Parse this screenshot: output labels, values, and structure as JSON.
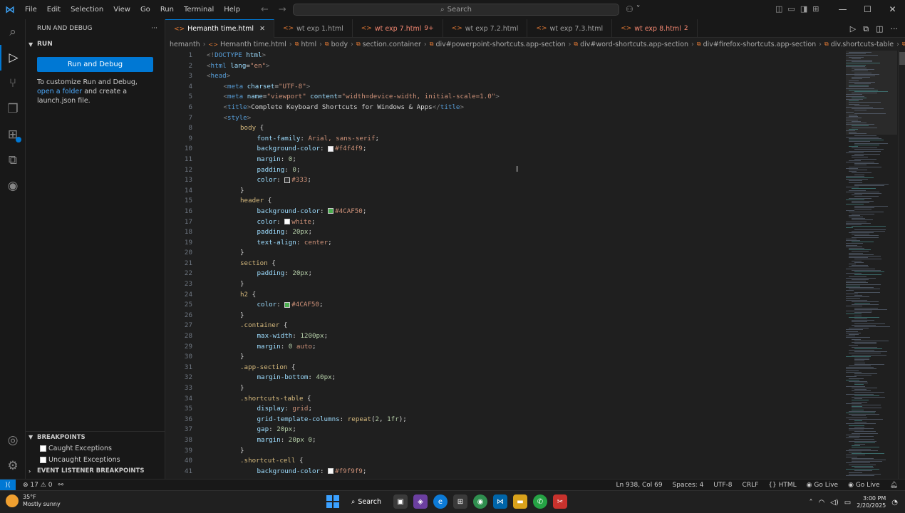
{
  "titlebar": {
    "menu": [
      "File",
      "Edit",
      "Selection",
      "View",
      "Go",
      "Run",
      "Terminal",
      "Help"
    ],
    "search_placeholder": "Search"
  },
  "sidebar": {
    "title": "RUN AND DEBUG",
    "more": "···",
    "run_section": "RUN",
    "run_button": "Run and Debug",
    "help_text_1": "To customize Run and Debug,",
    "help_link_1": "open a folder",
    "help_text_2": "and create a launch.json file.",
    "breakpoints": {
      "title": "BREAKPOINTS",
      "items": [
        "Caught Exceptions",
        "Uncaught Exceptions"
      ],
      "event_listener": "EVENT LISTENER BREAKPOINTS"
    }
  },
  "tabs": [
    {
      "label": "Hemanth time.html",
      "active": true,
      "error": false,
      "suffix": ""
    },
    {
      "label": "wt exp 1.html",
      "active": false,
      "error": false,
      "suffix": ""
    },
    {
      "label": "wt exp 7.html",
      "active": false,
      "error": true,
      "suffix": "9+"
    },
    {
      "label": "wt exp 7.2.html",
      "active": false,
      "error": false,
      "suffix": ""
    },
    {
      "label": "wt exp 7.3.html",
      "active": false,
      "error": false,
      "suffix": ""
    },
    {
      "label": "wt exp 8.html",
      "active": false,
      "error": true,
      "suffix": "2"
    }
  ],
  "breadcrumbs": [
    "hemanth",
    "Hemanth time.html",
    "html",
    "body",
    "section.container",
    "div#powerpoint-shortcuts.app-section",
    "div#word-shortcuts.app-section",
    "div#firefox-shortcuts.app-section",
    "div.shortcuts-table",
    "div"
  ],
  "code_lines": [
    {
      "n": "1",
      "i": 0,
      "tokens": [
        [
          "p",
          "<!"
        ],
        [
          "t",
          "DOCTYPE"
        ],
        [
          "a",
          " html"
        ],
        [
          "p",
          ">"
        ]
      ]
    },
    {
      "n": "2",
      "i": 0,
      "tokens": [
        [
          "p",
          "<"
        ],
        [
          "t",
          "html"
        ],
        [
          "a",
          " lang"
        ],
        [
          "d",
          "="
        ],
        [
          "s",
          "\"en\""
        ],
        [
          "p",
          ">"
        ]
      ]
    },
    {
      "n": "3",
      "i": 0,
      "tokens": [
        [
          "p",
          "<"
        ],
        [
          "t",
          "head"
        ],
        [
          "p",
          ">"
        ]
      ]
    },
    {
      "n": "4",
      "i": 1,
      "tokens": [
        [
          "p",
          "<"
        ],
        [
          "t",
          "meta"
        ],
        [
          "a",
          " charset"
        ],
        [
          "d",
          "="
        ],
        [
          "s",
          "\"UTF-8\""
        ],
        [
          "p",
          ">"
        ]
      ]
    },
    {
      "n": "5",
      "i": 1,
      "tokens": [
        [
          "p",
          "<"
        ],
        [
          "t",
          "meta"
        ],
        [
          "a",
          " name"
        ],
        [
          "d",
          "="
        ],
        [
          "s",
          "\"viewport\""
        ],
        [
          "a",
          " content"
        ],
        [
          "d",
          "="
        ],
        [
          "s",
          "\"width=device-width, initial-scale=1.0\""
        ],
        [
          "p",
          ">"
        ]
      ]
    },
    {
      "n": "6",
      "i": 1,
      "tokens": [
        [
          "p",
          "<"
        ],
        [
          "t",
          "title"
        ],
        [
          "p",
          ">"
        ],
        [
          "d",
          "Complete Keyboard Shortcuts for Windows & Apps"
        ],
        [
          "p",
          "</"
        ],
        [
          "t",
          "title"
        ],
        [
          "p",
          ">"
        ]
      ]
    },
    {
      "n": "7",
      "i": 1,
      "tokens": [
        [
          "p",
          "<"
        ],
        [
          "t",
          "style"
        ],
        [
          "p",
          ">"
        ]
      ]
    },
    {
      "n": "8",
      "i": 2,
      "tokens": [
        [
          "sel",
          "body"
        ],
        [
          "d",
          " {"
        ]
      ]
    },
    {
      "n": "9",
      "i": 3,
      "tokens": [
        [
          "k",
          "font-family"
        ],
        [
          "d",
          ": "
        ],
        [
          "v",
          "Arial, sans-serif"
        ],
        [
          "d",
          ";"
        ]
      ]
    },
    {
      "n": "10",
      "i": 3,
      "tokens": [
        [
          "k",
          "background-color"
        ],
        [
          "d",
          ": "
        ],
        [
          "sw",
          "#f4f4f9"
        ],
        [
          "v",
          "#f4f4f9"
        ],
        [
          "d",
          ";"
        ]
      ]
    },
    {
      "n": "11",
      "i": 3,
      "tokens": [
        [
          "k",
          "margin"
        ],
        [
          "d",
          ": "
        ],
        [
          "n",
          "0"
        ],
        [
          "d",
          ";"
        ]
      ]
    },
    {
      "n": "12",
      "i": 3,
      "tokens": [
        [
          "k",
          "padding"
        ],
        [
          "d",
          ": "
        ],
        [
          "n",
          "0"
        ],
        [
          "d",
          ";"
        ]
      ]
    },
    {
      "n": "13",
      "i": 3,
      "tokens": [
        [
          "k",
          "color"
        ],
        [
          "d",
          ": "
        ],
        [
          "sw",
          "#333"
        ],
        [
          "v",
          "#333"
        ],
        [
          "d",
          ";"
        ]
      ]
    },
    {
      "n": "14",
      "i": 2,
      "tokens": [
        [
          "d",
          "}"
        ]
      ]
    },
    {
      "n": "15",
      "i": 2,
      "tokens": [
        [
          "sel",
          "header"
        ],
        [
          "d",
          " {"
        ]
      ]
    },
    {
      "n": "16",
      "i": 3,
      "tokens": [
        [
          "k",
          "background-color"
        ],
        [
          "d",
          ": "
        ],
        [
          "sw",
          "#4CAF50"
        ],
        [
          "v",
          "#4CAF50"
        ],
        [
          "d",
          ";"
        ]
      ]
    },
    {
      "n": "17",
      "i": 3,
      "tokens": [
        [
          "k",
          "color"
        ],
        [
          "d",
          ": "
        ],
        [
          "sw",
          "white"
        ],
        [
          "v",
          "white"
        ],
        [
          "d",
          ";"
        ]
      ]
    },
    {
      "n": "18",
      "i": 3,
      "tokens": [
        [
          "k",
          "padding"
        ],
        [
          "d",
          ": "
        ],
        [
          "n",
          "20px"
        ],
        [
          "d",
          ";"
        ]
      ]
    },
    {
      "n": "19",
      "i": 3,
      "tokens": [
        [
          "k",
          "text-align"
        ],
        [
          "d",
          ": "
        ],
        [
          "v",
          "center"
        ],
        [
          "d",
          ";"
        ]
      ]
    },
    {
      "n": "20",
      "i": 2,
      "tokens": [
        [
          "d",
          "}"
        ]
      ]
    },
    {
      "n": "21",
      "i": 2,
      "tokens": [
        [
          "sel",
          "section"
        ],
        [
          "d",
          " {"
        ]
      ]
    },
    {
      "n": "22",
      "i": 3,
      "tokens": [
        [
          "k",
          "padding"
        ],
        [
          "d",
          ": "
        ],
        [
          "n",
          "20px"
        ],
        [
          "d",
          ";"
        ]
      ]
    },
    {
      "n": "23",
      "i": 2,
      "tokens": [
        [
          "d",
          "}"
        ]
      ]
    },
    {
      "n": "24",
      "i": 2,
      "tokens": [
        [
          "sel",
          "h2"
        ],
        [
          "d",
          " {"
        ]
      ]
    },
    {
      "n": "25",
      "i": 3,
      "tokens": [
        [
          "k",
          "color"
        ],
        [
          "d",
          ": "
        ],
        [
          "sw",
          "#4CAF50"
        ],
        [
          "v",
          "#4CAF50"
        ],
        [
          "d",
          ";"
        ]
      ]
    },
    {
      "n": "26",
      "i": 2,
      "tokens": [
        [
          "d",
          "}"
        ]
      ]
    },
    {
      "n": "27",
      "i": 2,
      "tokens": [
        [
          "sel",
          ".container"
        ],
        [
          "d",
          " {"
        ]
      ]
    },
    {
      "n": "28",
      "i": 3,
      "tokens": [
        [
          "k",
          "max-width"
        ],
        [
          "d",
          ": "
        ],
        [
          "n",
          "1200px"
        ],
        [
          "d",
          ";"
        ]
      ]
    },
    {
      "n": "29",
      "i": 3,
      "tokens": [
        [
          "k",
          "margin"
        ],
        [
          "d",
          ": "
        ],
        [
          "n",
          "0"
        ],
        [
          "v",
          " auto"
        ],
        [
          "d",
          ";"
        ]
      ]
    },
    {
      "n": "30",
      "i": 2,
      "tokens": [
        [
          "d",
          "}"
        ]
      ]
    },
    {
      "n": "31",
      "i": 2,
      "tokens": [
        [
          "sel",
          ".app-section"
        ],
        [
          "d",
          " {"
        ]
      ]
    },
    {
      "n": "32",
      "i": 3,
      "tokens": [
        [
          "k",
          "margin-bottom"
        ],
        [
          "d",
          ": "
        ],
        [
          "n",
          "40px"
        ],
        [
          "d",
          ";"
        ]
      ]
    },
    {
      "n": "33",
      "i": 2,
      "tokens": [
        [
          "d",
          "}"
        ]
      ]
    },
    {
      "n": "34",
      "i": 2,
      "tokens": [
        [
          "sel",
          ".shortcuts-table"
        ],
        [
          "d",
          " {"
        ]
      ]
    },
    {
      "n": "35",
      "i": 3,
      "tokens": [
        [
          "k",
          "display"
        ],
        [
          "d",
          ": "
        ],
        [
          "v",
          "grid"
        ],
        [
          "d",
          ";"
        ]
      ]
    },
    {
      "n": "36",
      "i": 3,
      "tokens": [
        [
          "k",
          "grid-template-columns"
        ],
        [
          "d",
          ": "
        ],
        [
          "fn",
          "repeat"
        ],
        [
          "d",
          "("
        ],
        [
          "n",
          "2"
        ],
        [
          "d",
          ", "
        ],
        [
          "n",
          "1fr"
        ],
        [
          "d",
          ");"
        ]
      ]
    },
    {
      "n": "37",
      "i": 3,
      "tokens": [
        [
          "k",
          "gap"
        ],
        [
          "d",
          ": "
        ],
        [
          "n",
          "20px"
        ],
        [
          "d",
          ";"
        ]
      ]
    },
    {
      "n": "38",
      "i": 3,
      "tokens": [
        [
          "k",
          "margin"
        ],
        [
          "d",
          ": "
        ],
        [
          "n",
          "20px"
        ],
        [
          "d",
          " "
        ],
        [
          "n",
          "0"
        ],
        [
          "d",
          ";"
        ]
      ]
    },
    {
      "n": "39",
      "i": 2,
      "tokens": [
        [
          "d",
          "}"
        ]
      ]
    },
    {
      "n": "40",
      "i": 2,
      "tokens": [
        [
          "sel",
          ".shortcut-cell"
        ],
        [
          "d",
          " {"
        ]
      ]
    },
    {
      "n": "41",
      "i": 3,
      "tokens": [
        [
          "k",
          "background-color"
        ],
        [
          "d",
          ": "
        ],
        [
          "sw",
          "#f9f9f9"
        ],
        [
          "v",
          "#f9f9f9"
        ],
        [
          "d",
          ";"
        ]
      ]
    }
  ],
  "statusbar": {
    "errors": "17",
    "warnings": "0",
    "position": "Ln 938, Col 69",
    "spaces": "Spaces: 4",
    "encoding": "UTF-8",
    "eol": "CRLF",
    "language": "HTML",
    "golive_1": "Go Live",
    "golive_2": "Go Live"
  },
  "taskbar": {
    "temperature": "35°F",
    "weather": "Mostly sunny",
    "search": "Search",
    "time": "3:00 PM",
    "date": "2/20/2025"
  },
  "colors": {
    "accent": "#0078d4",
    "error_tab": "#f48771",
    "swatch_green": "#4CAF50"
  }
}
